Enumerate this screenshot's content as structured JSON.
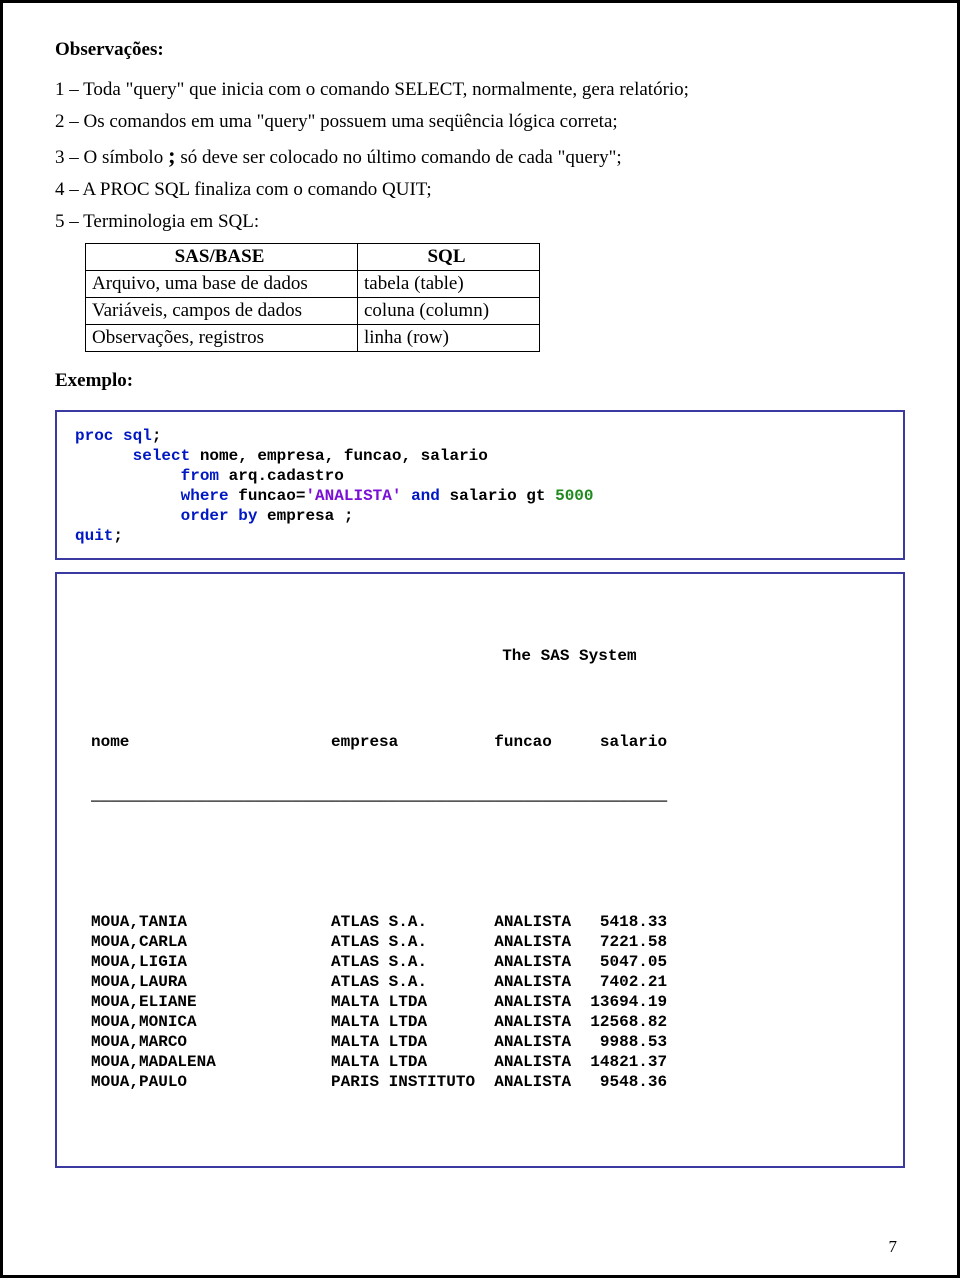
{
  "headings": {
    "observacoes": "Observações:",
    "exemplo": "Exemplo:"
  },
  "observations": {
    "o1": "1 – Toda \"query\" que inicia com o comando SELECT, normalmente, gera relatório;",
    "o2": "2 – Os comandos em uma \"query\" possuem uma seqüência lógica correta;",
    "o3_pre": "3 – O símbolo   ",
    "o3_symbol": ";",
    "o3_post": "   só deve ser colocado no último comando de cada \"query\";",
    "o4": "4 – A PROC SQL finaliza com o comando QUIT;",
    "o5": "5 – Terminologia em SQL:"
  },
  "terminology": {
    "h_left": "SAS/BASE",
    "h_right": "SQL",
    "rows": [
      {
        "l": "Arquivo, uma base de dados",
        "r": "tabela (table)"
      },
      {
        "l": "Variáveis, campos de dados",
        "r": "coluna (column)"
      },
      {
        "l": "Observações, registros",
        "r": "linha (row)"
      }
    ]
  },
  "code": {
    "proc": "proc",
    "sql": "sql",
    "select": "select",
    "cols": " nome, empresa, funcao, salario",
    "from": "from",
    "tbl": " arq.cadastro",
    "where": "where",
    "wcol1": " funcao=",
    "str": "'ANALISTA'",
    "and": " and",
    "wcol2": " salario gt ",
    "num": "5000",
    "orderby": "order by",
    "obexpr": " empresa ;",
    "quit": "quit"
  },
  "output": {
    "title": "The SAS System",
    "headers": [
      "nome",
      "empresa",
      "funcao",
      "salario"
    ],
    "rows": [
      {
        "nome": "MOUA,TANIA",
        "empresa": "ATLAS S.A.",
        "funcao": "ANALISTA",
        "salario": "5418.33"
      },
      {
        "nome": "MOUA,CARLA",
        "empresa": "ATLAS S.A.",
        "funcao": "ANALISTA",
        "salario": "7221.58"
      },
      {
        "nome": "MOUA,LIGIA",
        "empresa": "ATLAS S.A.",
        "funcao": "ANALISTA",
        "salario": "5047.05"
      },
      {
        "nome": "MOUA,LAURA",
        "empresa": "ATLAS S.A.",
        "funcao": "ANALISTA",
        "salario": "7402.21"
      },
      {
        "nome": "MOUA,ELIANE",
        "empresa": "MALTA LTDA",
        "funcao": "ANALISTA",
        "salario": "13694.19"
      },
      {
        "nome": "MOUA,MONICA",
        "empresa": "MALTA LTDA",
        "funcao": "ANALISTA",
        "salario": "12568.82"
      },
      {
        "nome": "MOUA,MARCO",
        "empresa": "MALTA LTDA",
        "funcao": "ANALISTA",
        "salario": "9988.53"
      },
      {
        "nome": "MOUA,MADALENA",
        "empresa": "MALTA LTDA",
        "funcao": "ANALISTA",
        "salario": "14821.37"
      },
      {
        "nome": "MOUA,PAULO",
        "empresa": "PARIS INSTITUTO",
        "funcao": "ANALISTA",
        "salario": "9548.36"
      }
    ],
    "col_widths": {
      "nome": 25,
      "empresa": 17,
      "funcao": 10,
      "salario": 8
    }
  },
  "page_number": "7"
}
